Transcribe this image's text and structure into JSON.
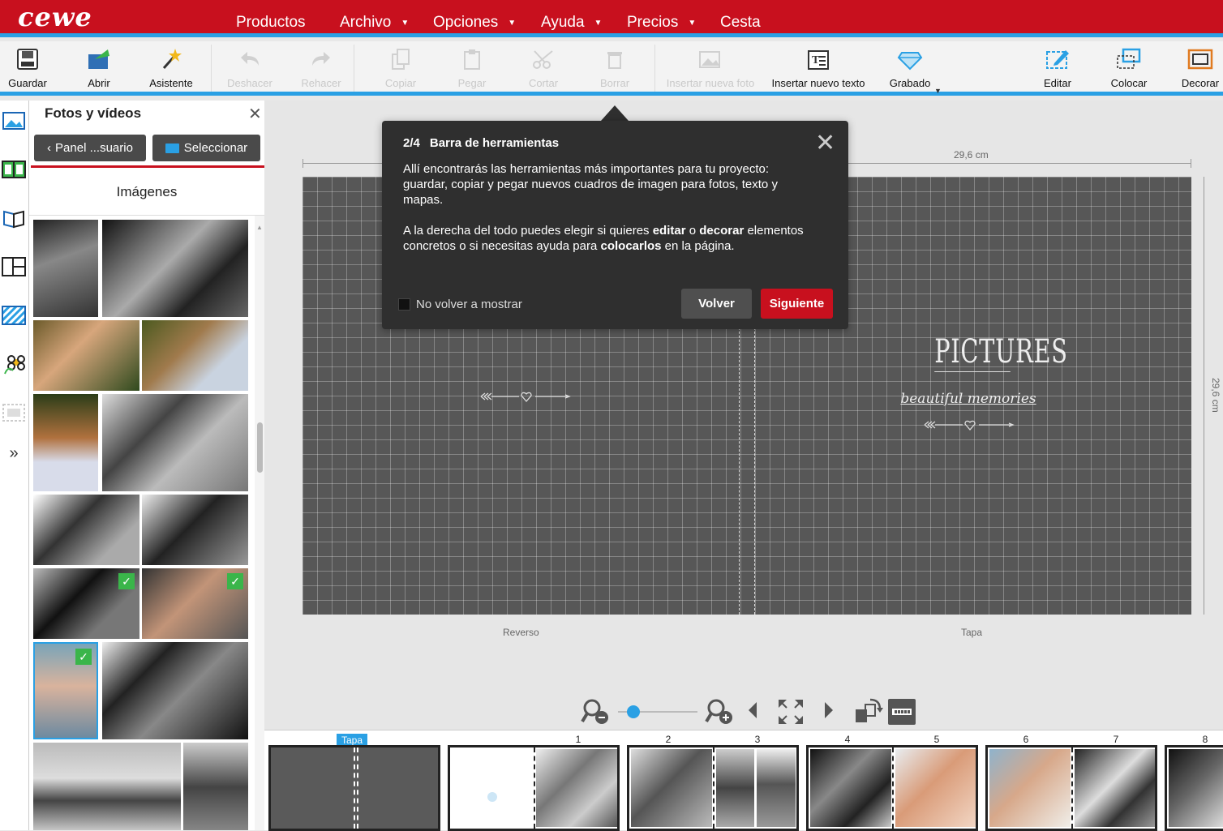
{
  "brand": {
    "logo": "cewe"
  },
  "menu": [
    {
      "label": "Productos",
      "has_caret": false
    },
    {
      "label": "Archivo",
      "has_caret": true
    },
    {
      "label": "Opciones",
      "has_caret": true
    },
    {
      "label": "Ayuda",
      "has_caret": true
    },
    {
      "label": "Precios",
      "has_caret": true
    },
    {
      "label": "Cesta",
      "has_caret": false
    }
  ],
  "toolbar": {
    "guardar": "Guardar",
    "abrir": "Abrir",
    "asistente": "Asistente",
    "deshacer": "Deshacer",
    "rehacer": "Rehacer",
    "copiar": "Copiar",
    "pegar": "Pegar",
    "cortar": "Cortar",
    "borrar": "Borrar",
    "insertar_foto": "Insertar nueva foto",
    "insertar_texto": "Insertar nuevo texto",
    "grabado": "Grabado",
    "editar": "Editar",
    "colocar": "Colocar",
    "decorar": "Decorar"
  },
  "panel": {
    "title": "Fotos y vídeos",
    "back_button": "Panel ...suario",
    "select_button": "Seleccionar",
    "subheading": "Imágenes"
  },
  "canvas": {
    "width_label": "29,6 cm",
    "height_label": "29,6 cm",
    "left_page_label": "Reverso",
    "right_page_label": "Tapa",
    "cover_title": "PICTURES",
    "cover_subtitle": "beautiful memories"
  },
  "modal": {
    "step": "2/4",
    "title": "Barra de herramientas",
    "para1": "Allí encontrarás las herramientas más importantes para tu proyecto: guardar, copiar y pegar nuevos cuadros de imagen para fotos, texto y mapas.",
    "para2_a": "A la derecha del todo puedes elegir si quieres ",
    "para2_b": "editar",
    "para2_c": " o ",
    "para2_d": "decorar",
    "para2_e": " elementos concretos o si necesitas ayuda para ",
    "para2_f": "colocarlos",
    "para2_g": " en la página.",
    "checkbox_label": "No volver a mostrar",
    "back_button": "Volver",
    "next_button": "Siguiente"
  },
  "strip": {
    "cover_tag": "Tapa",
    "page_numbers": [
      "1",
      "2",
      "3",
      "4",
      "5",
      "6",
      "7",
      "8"
    ]
  },
  "colors": {
    "brand_red": "#c8101e",
    "accent_blue": "#2aa0e4",
    "check_green": "#3ab54a"
  }
}
